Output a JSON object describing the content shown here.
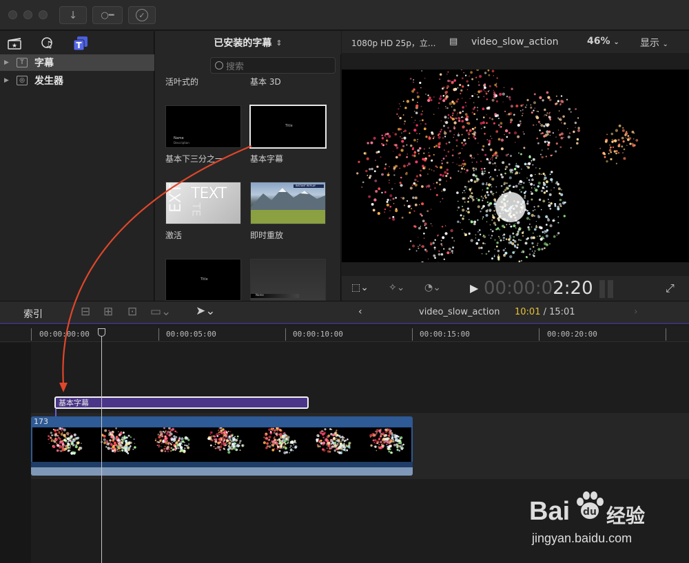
{
  "window": {
    "toolbar": {
      "import_icon": "download-arrow-icon",
      "keyword_icon": "key-icon",
      "check_icon": "checkmark-icon"
    }
  },
  "sidebar": {
    "tabs": [
      "clapper-star-icon",
      "music-photo-icon",
      "titles-generators-icon"
    ],
    "items": [
      {
        "label": "字幕",
        "icon": "T",
        "selected": true
      },
      {
        "label": "发生器",
        "icon": "◎",
        "selected": false
      }
    ]
  },
  "browser": {
    "dropdown_label": "已安装的字幕",
    "search_placeholder": "搜索",
    "top_labels": [
      "活叶式的",
      "基本 3D"
    ],
    "items": [
      {
        "label": "基本下三分之一",
        "overlay": "Name",
        "overlay2": "Description"
      },
      {
        "label": "基本字幕",
        "overlay": "Title",
        "selected": true
      },
      {
        "label": "激活",
        "overlay": "TEXT"
      },
      {
        "label": "即时重放",
        "overlay": "INSTANT REPLAY"
      },
      {
        "label": "",
        "overlay": "Title"
      },
      {
        "label": "",
        "overlay": "Name",
        "overlay2": "Description"
      }
    ]
  },
  "viewer": {
    "format_label": "1080p HD 25p，立...",
    "project_name": "video_slow_action",
    "zoom": "46%",
    "display_menu": "显示",
    "timecode_dim": "00:00:0",
    "timecode_bright": "2:20",
    "colors": {
      "accent": "#6b5bd6",
      "firework_red": "#e0305a",
      "firework_white": "#ffffff"
    }
  },
  "timeline": {
    "index_label": "索引",
    "project_name": "video_slow_action",
    "position_current": "10:01",
    "position_sep": " / ",
    "position_total": "15:01",
    "ruler": [
      "00:00:00:00",
      "00:00:05:00",
      "00:00:10:00",
      "00:00:15:00",
      "00:00:20:00"
    ],
    "title_clip": "基本字幕",
    "video_clip_label": "173",
    "colors": {
      "title_clip": "#5a3f96",
      "video_clip": "#2e5a95",
      "playhead": "#c7c7c7",
      "timecode_yellow": "#e8c233"
    }
  },
  "watermark": {
    "brand": "Bai",
    "brand2": "经验",
    "url": "jingyan.baidu.com"
  },
  "annotation": {
    "arrow_color": "#e0462a"
  }
}
